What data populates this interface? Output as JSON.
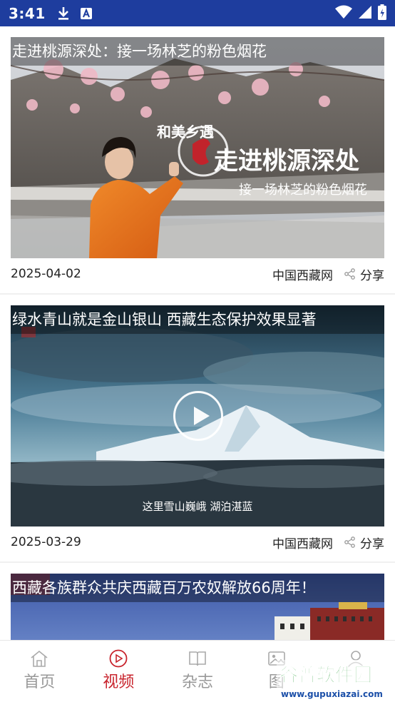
{
  "status_bar": {
    "time": "3:41"
  },
  "feed": [
    {
      "title": "走进桃源深处：接一场林芝的粉色烟花",
      "overlay_brand": "和美乡遇",
      "overlay_main": "走进桃源深处",
      "overlay_sub": "接一场林芝的粉色烟花",
      "date": "2025-04-02",
      "source": "中国西藏网",
      "share_label": "分享"
    },
    {
      "title": "绿水青山就是金山银山 西藏生态保护效果显著",
      "caption": "这里雪山巍峨 湖泊湛蓝",
      "date": "2025-03-29",
      "source": "中国西藏网",
      "share_label": "分享"
    },
    {
      "title": "西藏各族群众共庆西藏百万农奴解放66周年！"
    }
  ],
  "bottom_nav": [
    {
      "label": "首页",
      "icon": "home-icon"
    },
    {
      "label": "视频",
      "icon": "video-icon",
      "active": true
    },
    {
      "label": "杂志",
      "icon": "magazine-icon"
    },
    {
      "label": "图",
      "icon": "picture-icon"
    },
    {
      "label": "",
      "icon": "profile-icon"
    }
  ],
  "watermark": {
    "title": "谷普软件园",
    "url": "www.gupuxiazai.com"
  }
}
